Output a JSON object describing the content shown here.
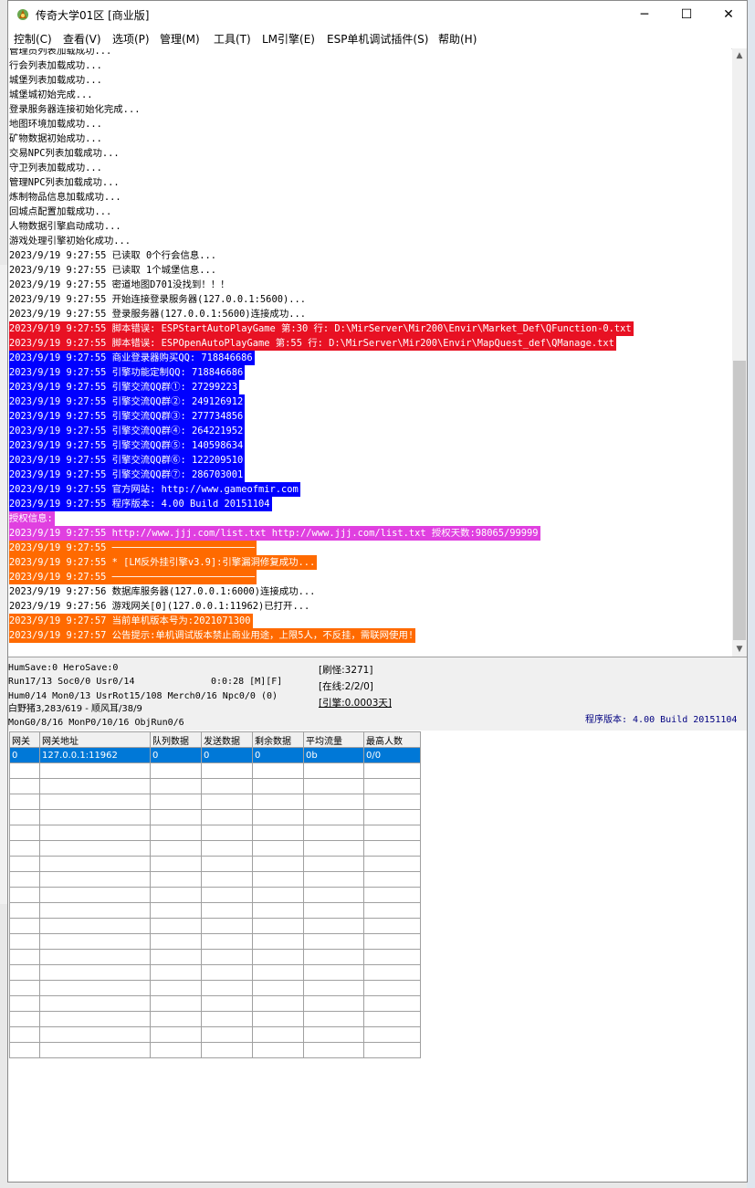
{
  "window": {
    "title": "传奇大学01区 [商业版]",
    "minimize": "─",
    "maximize": "☐",
    "close": "✕"
  },
  "menu": [
    "控制(C)",
    "查看(V)",
    "选项(P)",
    "管理(M)",
    "工具(T)",
    "LM引擎(E)",
    "ESP单机调试插件(S)",
    "帮助(H)"
  ],
  "colors": {
    "red": "#e81123",
    "blue": "#0000ff",
    "magenta": "#e040e0",
    "orange": "#ff6a00",
    "selection": "#0078d7"
  },
  "log": [
    {
      "text": "管理员列表加载成功...",
      "style": "plain"
    },
    {
      "text": "行会列表加载成功...",
      "style": "plain"
    },
    {
      "text": "城堡列表加载成功...",
      "style": "plain"
    },
    {
      "text": "城堡城初始完成...",
      "style": "plain"
    },
    {
      "text": "登录服务器连接初始化完成...",
      "style": "plain"
    },
    {
      "text": "地图环境加载成功...",
      "style": "plain"
    },
    {
      "text": "矿物数据初始成功...",
      "style": "plain"
    },
    {
      "text": "交易NPC列表加载成功...",
      "style": "plain"
    },
    {
      "text": "守卫列表加载成功...",
      "style": "plain"
    },
    {
      "text": "管理NPC列表加载成功...",
      "style": "plain"
    },
    {
      "text": "炼制物品信息加载成功...",
      "style": "plain"
    },
    {
      "text": "回城点配置加载成功...",
      "style": "plain"
    },
    {
      "text": "人物数据引擎启动成功...",
      "style": "plain"
    },
    {
      "text": "游戏处理引擎初始化成功...",
      "style": "plain"
    },
    {
      "text": "2023/9/19 9:27:55 已读取 0个行会信息...",
      "style": "plain"
    },
    {
      "text": "2023/9/19 9:27:55 已读取 1个城堡信息...",
      "style": "plain"
    },
    {
      "text": "2023/9/19 9:27:55 密道地图D701没找到！！！",
      "style": "plain"
    },
    {
      "text": "2023/9/19 9:27:55 开始连接登录服务器(127.0.0.1:5600)...",
      "style": "plain"
    },
    {
      "text": "2023/9/19 9:27:55 登录服务器(127.0.0.1:5600)连接成功...",
      "style": "plain"
    },
    {
      "text": "2023/9/19 9:27:55 脚本错误: ESPStartAutoPlayGame 第:30 行: D:\\MirServer\\Mir200\\Envir\\Market_Def\\QFunction-0.txt",
      "style": "red"
    },
    {
      "text": "2023/9/19 9:27:55 脚本错误: ESPOpenAutoPlayGame 第:55 行: D:\\MirServer\\Mir200\\Envir\\MapQuest_def\\QManage.txt",
      "style": "red"
    },
    {
      "text": "2023/9/19 9:27:55 商业登录器购买QQ: 718846686",
      "style": "blue"
    },
    {
      "text": "2023/9/19 9:27:55 引擎功能定制QQ: 718846686",
      "style": "blue"
    },
    {
      "text": "2023/9/19 9:27:55 引擎交流QQ群①: 27299223",
      "style": "blue"
    },
    {
      "text": "2023/9/19 9:27:55 引擎交流QQ群②: 249126912",
      "style": "blue"
    },
    {
      "text": "2023/9/19 9:27:55 引擎交流QQ群③: 277734856",
      "style": "blue"
    },
    {
      "text": "2023/9/19 9:27:55 引擎交流QQ群④: 264221952",
      "style": "blue"
    },
    {
      "text": "2023/9/19 9:27:55 引擎交流QQ群⑤: 140598634",
      "style": "blue"
    },
    {
      "text": "2023/9/19 9:27:55 引擎交流QQ群⑥: 122209510",
      "style": "blue"
    },
    {
      "text": "2023/9/19 9:27:55 引擎交流QQ群⑦: 286703001",
      "style": "blue"
    },
    {
      "text": "2023/9/19 9:27:55 官方网站: http://www.gameofmir.com",
      "style": "blue"
    },
    {
      "text": "2023/9/19 9:27:55 程序版本: 4.00 Build 20151104",
      "style": "blue"
    },
    {
      "text": "授权信息:",
      "style": "magenta"
    },
    {
      "text": "2023/9/19 9:27:55 http://www.jjj.com/list.txt http://www.jjj.com/list.txt 授权天数:98065/99999",
      "style": "magenta"
    },
    {
      "text": "2023/9/19 9:27:55 ─────────────────────────",
      "style": "orange"
    },
    {
      "text": "2023/9/19 9:27:55 * [LM反外挂引擎v3.9]:引擎漏洞修复成功...",
      "style": "orange"
    },
    {
      "text": "2023/9/19 9:27:55 ─────────────────────────",
      "style": "orange"
    },
    {
      "text": "2023/9/19 9:27:56 数据库服务器(127.0.0.1:6000)连接成功...",
      "style": "plain"
    },
    {
      "text": "2023/9/19 9:27:56 游戏网关[0](127.0.0.1:11962)已打开...",
      "style": "plain"
    },
    {
      "text": "2023/9/19 9:27:57 当前单机版本号为:2021071300",
      "style": "orange"
    },
    {
      "text": "2023/9/19 9:27:57 公告提示:单机调试版本禁止商业用途，上限5人，不反挂，需联网使用!",
      "style": "orange"
    }
  ],
  "status": {
    "line1": "HumSave:0 HeroSave:0",
    "line2": "Run17/13 Soc0/0 Usr0/14",
    "timer": "0:0:28 [M][F]",
    "line3": "Hum0/14 Mon0/13 UsrRot15/108 Merch0/16 Npc0/0 (0)",
    "line4": "白野猪3,283/619 - 顺风耳/38/9",
    "line5": "MonG0/8/16 MonP0/10/16 ObjRun0/6",
    "refresh": "[刷怪:3271]",
    "online": "[在线:2/2/0]",
    "engine": "[引擎:0.0003天]",
    "version": "程序版本: 4.00 Build 20151104"
  },
  "grid": {
    "headers": [
      "网关",
      "网关地址",
      "队列数据",
      "发送数据",
      "剩余数据",
      "平均流量",
      "最高人数"
    ],
    "rows": [
      [
        "0",
        "127.0.0.1:11962",
        "0",
        "0",
        "0",
        "0b",
        "0/0"
      ]
    ],
    "empty_rows": 19
  }
}
